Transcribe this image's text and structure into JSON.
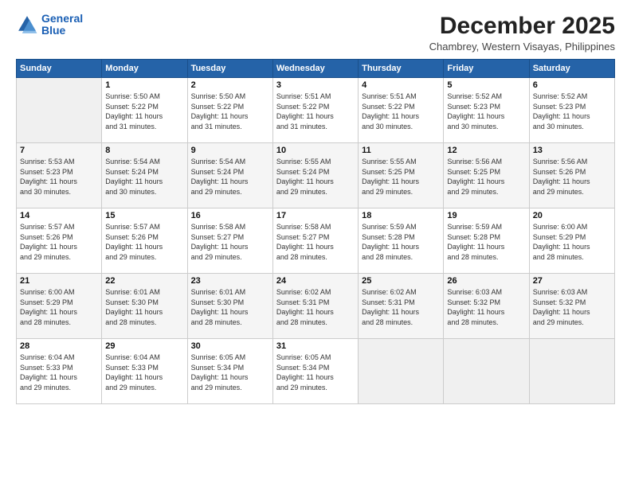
{
  "logo": {
    "line1": "General",
    "line2": "Blue"
  },
  "header": {
    "month": "December 2025",
    "location": "Chambrey, Western Visayas, Philippines"
  },
  "weekdays": [
    "Sunday",
    "Monday",
    "Tuesday",
    "Wednesday",
    "Thursday",
    "Friday",
    "Saturday"
  ],
  "weeks": [
    [
      {
        "day": "",
        "info": ""
      },
      {
        "day": "1",
        "info": "Sunrise: 5:50 AM\nSunset: 5:22 PM\nDaylight: 11 hours\nand 31 minutes."
      },
      {
        "day": "2",
        "info": "Sunrise: 5:50 AM\nSunset: 5:22 PM\nDaylight: 11 hours\nand 31 minutes."
      },
      {
        "day": "3",
        "info": "Sunrise: 5:51 AM\nSunset: 5:22 PM\nDaylight: 11 hours\nand 31 minutes."
      },
      {
        "day": "4",
        "info": "Sunrise: 5:51 AM\nSunset: 5:22 PM\nDaylight: 11 hours\nand 30 minutes."
      },
      {
        "day": "5",
        "info": "Sunrise: 5:52 AM\nSunset: 5:23 PM\nDaylight: 11 hours\nand 30 minutes."
      },
      {
        "day": "6",
        "info": "Sunrise: 5:52 AM\nSunset: 5:23 PM\nDaylight: 11 hours\nand 30 minutes."
      }
    ],
    [
      {
        "day": "7",
        "info": "Sunrise: 5:53 AM\nSunset: 5:23 PM\nDaylight: 11 hours\nand 30 minutes."
      },
      {
        "day": "8",
        "info": "Sunrise: 5:54 AM\nSunset: 5:24 PM\nDaylight: 11 hours\nand 30 minutes."
      },
      {
        "day": "9",
        "info": "Sunrise: 5:54 AM\nSunset: 5:24 PM\nDaylight: 11 hours\nand 29 minutes."
      },
      {
        "day": "10",
        "info": "Sunrise: 5:55 AM\nSunset: 5:24 PM\nDaylight: 11 hours\nand 29 minutes."
      },
      {
        "day": "11",
        "info": "Sunrise: 5:55 AM\nSunset: 5:25 PM\nDaylight: 11 hours\nand 29 minutes."
      },
      {
        "day": "12",
        "info": "Sunrise: 5:56 AM\nSunset: 5:25 PM\nDaylight: 11 hours\nand 29 minutes."
      },
      {
        "day": "13",
        "info": "Sunrise: 5:56 AM\nSunset: 5:26 PM\nDaylight: 11 hours\nand 29 minutes."
      }
    ],
    [
      {
        "day": "14",
        "info": "Sunrise: 5:57 AM\nSunset: 5:26 PM\nDaylight: 11 hours\nand 29 minutes."
      },
      {
        "day": "15",
        "info": "Sunrise: 5:57 AM\nSunset: 5:26 PM\nDaylight: 11 hours\nand 29 minutes."
      },
      {
        "day": "16",
        "info": "Sunrise: 5:58 AM\nSunset: 5:27 PM\nDaylight: 11 hours\nand 29 minutes."
      },
      {
        "day": "17",
        "info": "Sunrise: 5:58 AM\nSunset: 5:27 PM\nDaylight: 11 hours\nand 28 minutes."
      },
      {
        "day": "18",
        "info": "Sunrise: 5:59 AM\nSunset: 5:28 PM\nDaylight: 11 hours\nand 28 minutes."
      },
      {
        "day": "19",
        "info": "Sunrise: 5:59 AM\nSunset: 5:28 PM\nDaylight: 11 hours\nand 28 minutes."
      },
      {
        "day": "20",
        "info": "Sunrise: 6:00 AM\nSunset: 5:29 PM\nDaylight: 11 hours\nand 28 minutes."
      }
    ],
    [
      {
        "day": "21",
        "info": "Sunrise: 6:00 AM\nSunset: 5:29 PM\nDaylight: 11 hours\nand 28 minutes."
      },
      {
        "day": "22",
        "info": "Sunrise: 6:01 AM\nSunset: 5:30 PM\nDaylight: 11 hours\nand 28 minutes."
      },
      {
        "day": "23",
        "info": "Sunrise: 6:01 AM\nSunset: 5:30 PM\nDaylight: 11 hours\nand 28 minutes."
      },
      {
        "day": "24",
        "info": "Sunrise: 6:02 AM\nSunset: 5:31 PM\nDaylight: 11 hours\nand 28 minutes."
      },
      {
        "day": "25",
        "info": "Sunrise: 6:02 AM\nSunset: 5:31 PM\nDaylight: 11 hours\nand 28 minutes."
      },
      {
        "day": "26",
        "info": "Sunrise: 6:03 AM\nSunset: 5:32 PM\nDaylight: 11 hours\nand 28 minutes."
      },
      {
        "day": "27",
        "info": "Sunrise: 6:03 AM\nSunset: 5:32 PM\nDaylight: 11 hours\nand 29 minutes."
      }
    ],
    [
      {
        "day": "28",
        "info": "Sunrise: 6:04 AM\nSunset: 5:33 PM\nDaylight: 11 hours\nand 29 minutes."
      },
      {
        "day": "29",
        "info": "Sunrise: 6:04 AM\nSunset: 5:33 PM\nDaylight: 11 hours\nand 29 minutes."
      },
      {
        "day": "30",
        "info": "Sunrise: 6:05 AM\nSunset: 5:34 PM\nDaylight: 11 hours\nand 29 minutes."
      },
      {
        "day": "31",
        "info": "Sunrise: 6:05 AM\nSunset: 5:34 PM\nDaylight: 11 hours\nand 29 minutes."
      },
      {
        "day": "",
        "info": ""
      },
      {
        "day": "",
        "info": ""
      },
      {
        "day": "",
        "info": ""
      }
    ]
  ]
}
